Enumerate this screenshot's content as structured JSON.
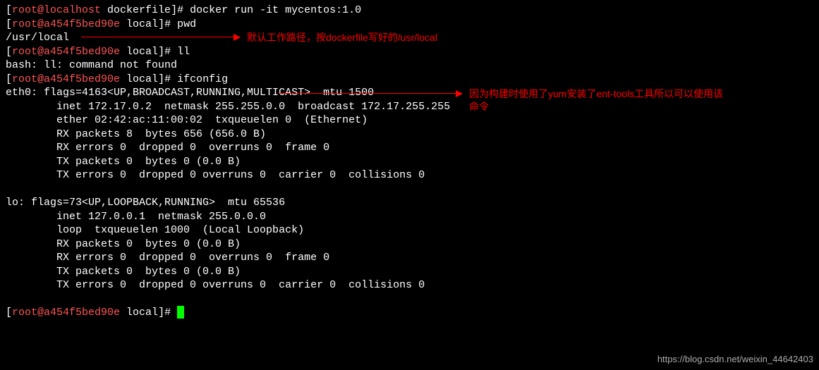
{
  "lines": {
    "l1_prompt_open": "[",
    "l1_userhost": "root@localhost",
    "l1_path": " dockerfile",
    "l1_prompt_close": "]# ",
    "l1_cmd": "docker run -it mycentos:1.0",
    "l2_prompt_open": "[",
    "l2_userhost": "root@a454f5bed90e",
    "l2_path": " local",
    "l2_prompt_close": "]# ",
    "l2_cmd": "pwd",
    "l3_output": "/usr/local",
    "l4_prompt_open": "[",
    "l4_userhost": "root@a454f5bed90e",
    "l4_path": " local",
    "l4_prompt_close": "]# ",
    "l4_cmd": "ll",
    "l5_output": "bash: ll: command not found",
    "l6_prompt_open": "[",
    "l6_userhost": "root@a454f5bed90e",
    "l6_path": " local",
    "l6_prompt_close": "]# ",
    "l6_cmd": "ifconfig",
    "l7": "eth0: flags=4163<UP,BROADCAST,RUNNING,MULTICAST>  mtu 1500",
    "l8": "        inet 172.17.0.2  netmask 255.255.0.0  broadcast 172.17.255.255",
    "l9": "        ether 02:42:ac:11:00:02  txqueuelen 0  (Ethernet)",
    "l10": "        RX packets 8  bytes 656 (656.0 B)",
    "l11": "        RX errors 0  dropped 0  overruns 0  frame 0",
    "l12": "        TX packets 0  bytes 0 (0.0 B)",
    "l13": "        TX errors 0  dropped 0 overruns 0  carrier 0  collisions 0",
    "l14": "",
    "l15": "lo: flags=73<UP,LOOPBACK,RUNNING>  mtu 65536",
    "l16": "        inet 127.0.0.1  netmask 255.0.0.0",
    "l17": "        loop  txqueuelen 1000  (Local Loopback)",
    "l18": "        RX packets 0  bytes 0 (0.0 B)",
    "l19": "        RX errors 0  dropped 0  overruns 0  frame 0",
    "l20": "        TX packets 0  bytes 0 (0.0 B)",
    "l21": "        TX errors 0  dropped 0 overruns 0  carrier 0  collisions 0",
    "l22": "",
    "l23_prompt_open": "[",
    "l23_userhost": "root@a454f5bed90e",
    "l23_path": " local",
    "l23_prompt_close": "]# "
  },
  "annotations": {
    "a1": "默认工作路径，按dockerfile写好的/usr/local",
    "a2_line1": "因为构建时使用了yum安装了ent-tools工具所以可以使用该",
    "a2_line2": "命令"
  },
  "watermark": "https://blog.csdn.net/weixin_44642403"
}
